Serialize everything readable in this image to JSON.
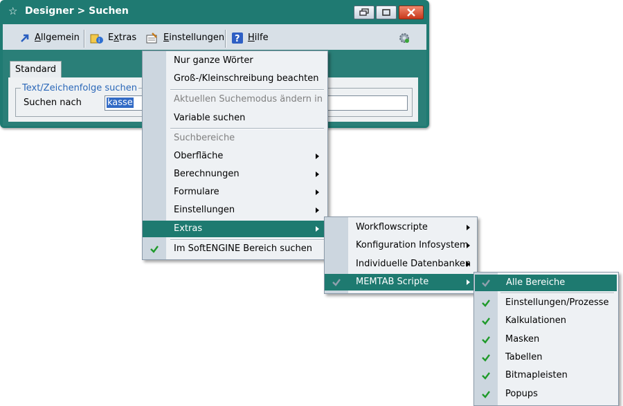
{
  "window": {
    "title": "Designer > Suchen",
    "buttons": [
      "restore-icon",
      "maximize-icon",
      "close-icon"
    ]
  },
  "toolbar": {
    "items": [
      {
        "label": "Allgemein",
        "accel": "A",
        "icon": "arrow-icon"
      },
      {
        "label": "Extras",
        "accel": "x",
        "icon": "extras-icon"
      },
      {
        "label": "Einstellungen",
        "accel": "E",
        "icon": "settings-icon"
      },
      {
        "label": "Hilfe",
        "accel": "H",
        "icon": "help-icon"
      }
    ],
    "right_icon": "gear-icon"
  },
  "tab": {
    "label": "Standard"
  },
  "search_group": {
    "legend": "Text/Zeichenfolge suchen",
    "label": "Suchen nach",
    "value": "kasse"
  },
  "menu1": {
    "items": [
      {
        "label": "Nur ganze Wörter",
        "type": "item"
      },
      {
        "label": "Groß-/Kleinschreibung beachten",
        "type": "item"
      },
      {
        "type": "sep"
      },
      {
        "label": "Aktuellen Suchemodus ändern  in",
        "type": "disabled"
      },
      {
        "label": "Variable suchen",
        "type": "item"
      },
      {
        "type": "sep"
      },
      {
        "label": "Suchbereiche",
        "type": "disabled"
      },
      {
        "label": "Oberfläche",
        "type": "submenu"
      },
      {
        "label": "Berechnungen",
        "type": "submenu"
      },
      {
        "label": "Formulare",
        "type": "submenu"
      },
      {
        "label": "Einstellungen",
        "type": "submenu"
      },
      {
        "label": "Extras",
        "type": "submenu",
        "highlight": true
      },
      {
        "type": "sep"
      },
      {
        "label": "Im SoftENGINE Bereich suchen",
        "type": "item",
        "checked": true
      }
    ]
  },
  "menu2": {
    "items": [
      {
        "label": "Workflowscripte",
        "type": "submenu"
      },
      {
        "label": "Konfiguration Infosystem",
        "type": "submenu"
      },
      {
        "label": "Individuelle Datenbanken",
        "type": "submenu"
      },
      {
        "label": "MEMTAB Scripte",
        "type": "submenu",
        "highlight": true,
        "checked": true
      }
    ]
  },
  "menu3": {
    "items": [
      {
        "label": "Alle Bereiche",
        "highlight": true,
        "checked": true
      },
      {
        "label": "Einstellungen/Prozesse",
        "checked": true
      },
      {
        "label": "Kalkulationen",
        "checked": true
      },
      {
        "label": "Masken",
        "checked": true
      },
      {
        "label": "Tabellen",
        "checked": true
      },
      {
        "label": "Bitmapleisten",
        "checked": true
      },
      {
        "label": "Popups",
        "checked": true
      }
    ]
  },
  "colors": {
    "accent": "#1e7a70",
    "menu_bg": "#eef1f4",
    "check": "#1f9a2a"
  }
}
